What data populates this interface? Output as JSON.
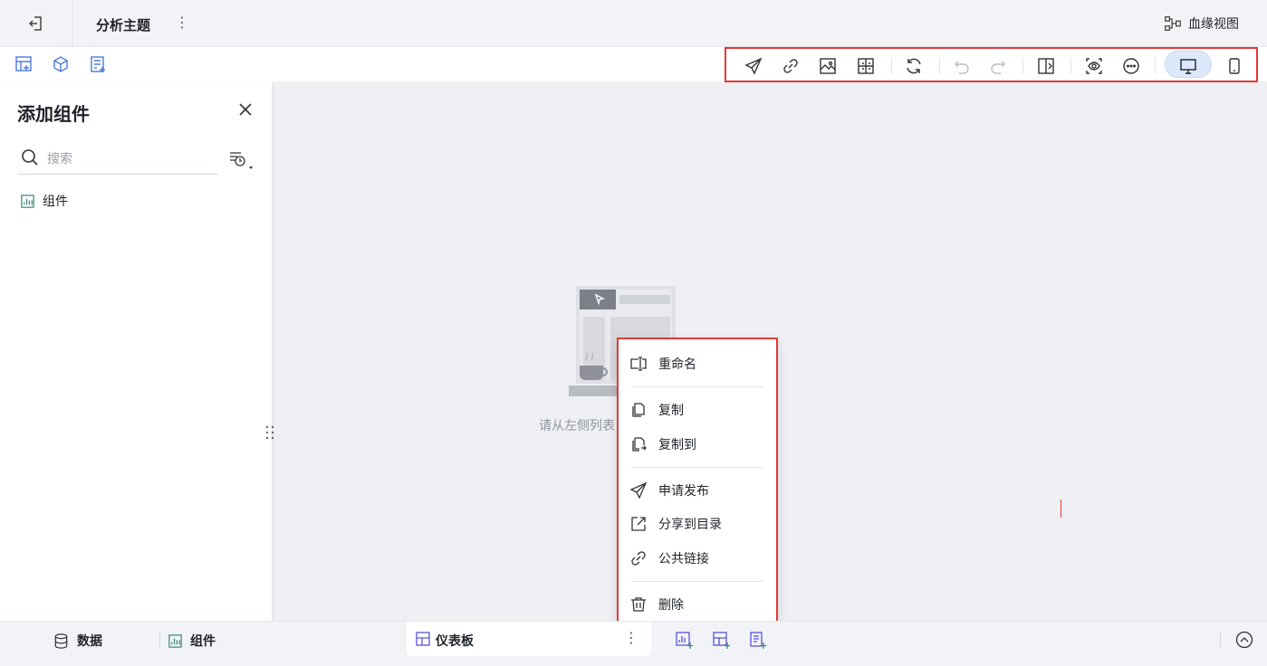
{
  "header": {
    "back_icon": "exit-icon",
    "theme_title": "分析主题",
    "more_glyph": "⋮",
    "lineage_label": "血缘视图"
  },
  "toolbar": {
    "left_icons": [
      "add-chart-icon",
      "add-dataset-icon",
      "add-table-icon"
    ],
    "right_icons": [
      "publish-icon",
      "link-icon",
      "image-export-icon",
      "layout-icon",
      "refresh-icon",
      "undo-icon",
      "redo-icon",
      "toggle-panel-icon",
      "preview-icon",
      "more-circle-icon",
      "desktop-icon",
      "mobile-icon"
    ],
    "active_device": "desktop"
  },
  "panel": {
    "title": "添加组件",
    "search_placeholder": "搜索",
    "items": [
      {
        "label": "组件"
      }
    ]
  },
  "canvas": {
    "empty_text": "请从左侧列表"
  },
  "context_menu": {
    "items": [
      {
        "label": "重命名",
        "icon": "rename-icon"
      },
      {
        "label": "复制",
        "icon": "copy-icon"
      },
      {
        "label": "复制到",
        "icon": "copy-to-icon"
      },
      {
        "label": "申请发布",
        "icon": "publish-request-icon"
      },
      {
        "label": "分享到目录",
        "icon": "share-icon"
      },
      {
        "label": "公共链接",
        "icon": "public-link-icon"
      },
      {
        "label": "删除",
        "icon": "trash-icon"
      }
    ]
  },
  "bottom": {
    "data_label": "数据",
    "component_label": "组件",
    "sheet_label": "仪表板",
    "more_glyph": "⋮"
  },
  "colors": {
    "accent": "#4b5bd8",
    "highlight": "#e53935",
    "active_device_bg": "#dce9fb"
  }
}
